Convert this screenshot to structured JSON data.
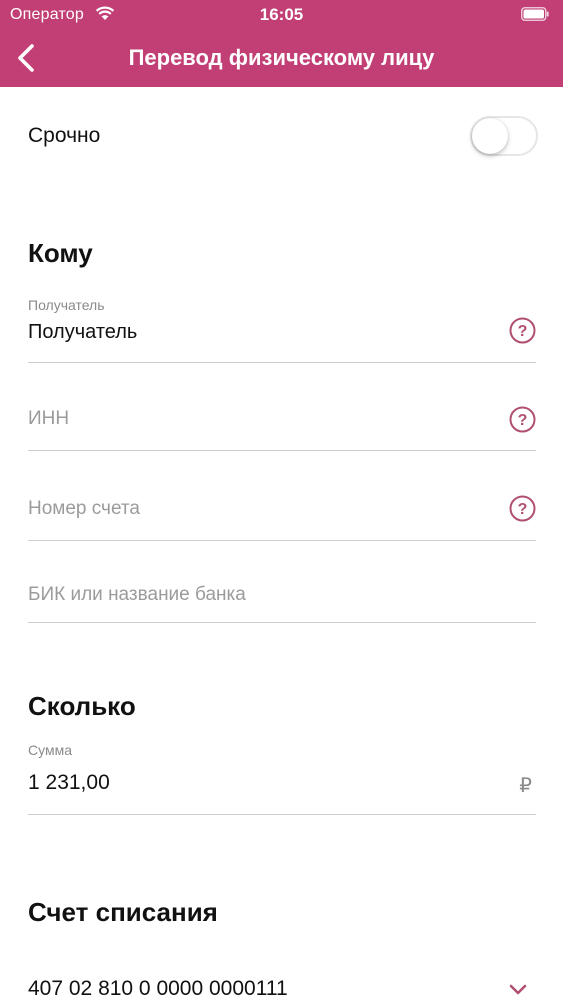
{
  "status_bar": {
    "carrier": "Оператор",
    "time": "16:05",
    "icons": [
      "wifi-icon",
      "battery-icon"
    ]
  },
  "nav": {
    "title": "Перевод физическому лицу",
    "back_icon": "chevron-left-icon"
  },
  "urgent": {
    "label": "Срочно",
    "toggle_on": false
  },
  "recipient_section": {
    "title": "Кому",
    "fields": [
      {
        "caption": "Получатель",
        "value": "Получатель",
        "placeholder": "",
        "help_icon": "question-circle-icon"
      },
      {
        "caption": "",
        "value": "",
        "placeholder": "ИНН",
        "help_icon": "question-circle-icon"
      },
      {
        "caption": "",
        "value": "",
        "placeholder": "Номер счета",
        "help_icon": "question-circle-icon"
      },
      {
        "caption": "",
        "value": "",
        "placeholder": "БИК или название банка"
      }
    ]
  },
  "amount_section": {
    "title": "Сколько",
    "caption": "Сумма",
    "value": "1 231,00",
    "currency": "₽"
  },
  "account_section": {
    "title": "Счет списания",
    "value": "407 02 810 0 0000 0000111",
    "chevron_icon": "chevron-down-icon"
  },
  "colors": {
    "brand": "#c13f75",
    "help_icon": "#b0506f",
    "divider": "#cfcfcf",
    "placeholder": "#9b9b9b"
  }
}
